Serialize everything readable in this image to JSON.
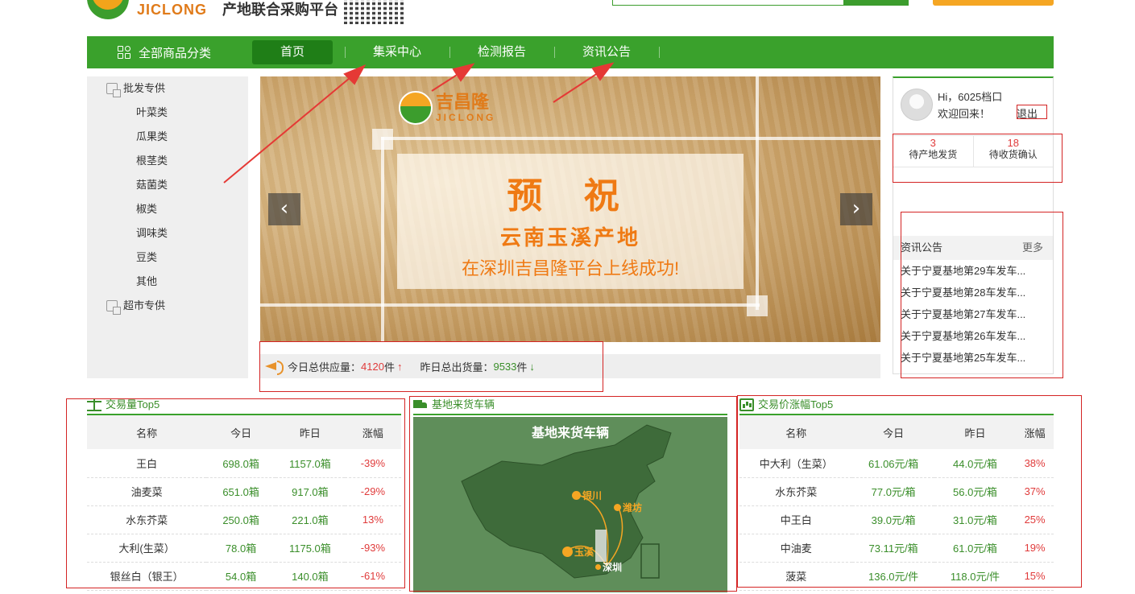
{
  "header": {
    "brand": "JICLONG",
    "slogan": "产地联合采购平台"
  },
  "nav": {
    "all_categories": "全部商品分类",
    "items": [
      {
        "label": "首页",
        "active": true
      },
      {
        "label": "集采中心",
        "active": false
      },
      {
        "label": "检测报告",
        "active": false
      },
      {
        "label": "资讯公告",
        "active": false
      }
    ]
  },
  "sidebar": {
    "groups": [
      {
        "label": "批发专供",
        "items": [
          "叶菜类",
          "瓜果类",
          "根茎类",
          "菇菌类",
          "椒类",
          "调味类",
          "豆类",
          "其他"
        ]
      },
      {
        "label": "超市专供",
        "items": []
      }
    ]
  },
  "banner": {
    "logo_cn": "吉昌隆",
    "logo_en": "JICLONG",
    "line1": "预 祝",
    "line2": "云南玉溪产地",
    "line3": "在深圳吉昌隆平台上线成功!",
    "prev": "‹",
    "next": "›"
  },
  "stats": {
    "supply_label": "今日总供应量：",
    "supply_value": "4120",
    "supply_unit": "件",
    "supply_trend": "↑",
    "shipped_label": "昨日总出货量：",
    "shipped_value": "9533",
    "shipped_unit": "件",
    "shipped_trend": "↓"
  },
  "user": {
    "greeting": "Hi，6025档口",
    "welcome": "欢迎回来！",
    "logout": "退出",
    "orders": [
      {
        "count": "3",
        "label": "待产地发货"
      },
      {
        "count": "18",
        "label": "待收货确认"
      }
    ]
  },
  "news": {
    "title": "资讯公告",
    "more": "更多",
    "items": [
      "关于宁夏基地第29车发车...",
      "关于宁夏基地第28车发车...",
      "关于宁夏基地第27车发车...",
      "关于宁夏基地第26车发车...",
      "关于宁夏基地第25车发车..."
    ]
  },
  "volume": {
    "title": "交易量Top5",
    "headers": [
      "名称",
      "今日",
      "昨日",
      "涨幅"
    ],
    "rows": [
      [
        "王白",
        "698.0箱",
        "1157.0箱",
        "-39%"
      ],
      [
        "油麦菜",
        "651.0箱",
        "917.0箱",
        "-29%"
      ],
      [
        "水东芥菜",
        "250.0箱",
        "221.0箱",
        "13%"
      ],
      [
        "大利(生菜）",
        "78.0箱",
        "1175.0箱",
        "-93%"
      ],
      [
        "银丝白（银王）",
        "54.0箱",
        "140.0箱",
        "-61%"
      ]
    ]
  },
  "trucks": {
    "title": "基地来货车辆",
    "map_title": "基地来货车辆",
    "cities": [
      "银川",
      "潍坊",
      "玉溪",
      "深圳"
    ]
  },
  "price": {
    "title": "交易价涨幅Top5",
    "headers": [
      "名称",
      "今日",
      "昨日",
      "涨幅"
    ],
    "rows": [
      [
        "中大利（生菜）",
        "61.06元/箱",
        "44.0元/箱",
        "38%"
      ],
      [
        "水东芥菜",
        "77.0元/箱",
        "56.0元/箱",
        "37%"
      ],
      [
        "中王白",
        "39.0元/箱",
        "31.0元/箱",
        "25%"
      ],
      [
        "中油麦",
        "73.11元/箱",
        "61.0元/箱",
        "19%"
      ],
      [
        "菠菜",
        "136.0元/件",
        "118.0元/件",
        "15%"
      ]
    ]
  },
  "colors": {
    "brand_green": "#3aa12c",
    "accent_orange": "#f5a623",
    "up_red": "#e03b3b",
    "annotation_red": "#d42424"
  }
}
